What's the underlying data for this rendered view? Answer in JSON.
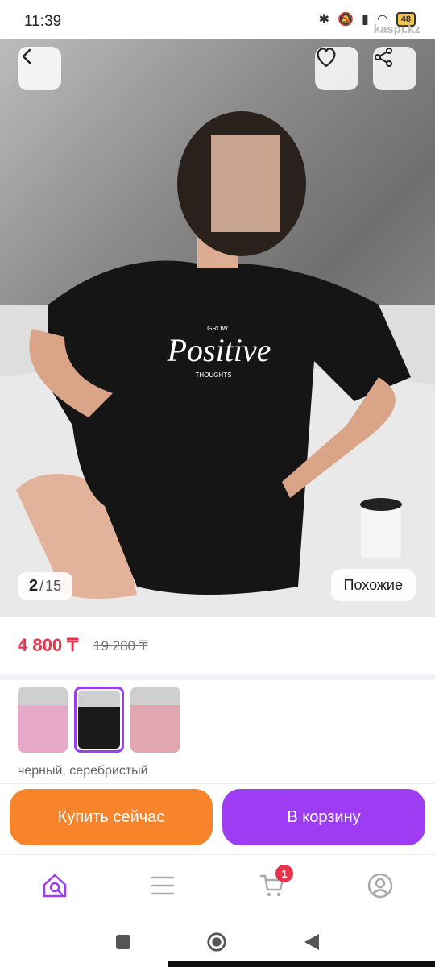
{
  "status": {
    "time": "11:39",
    "battery": "48",
    "watermark": "kaspi.kz"
  },
  "hero": {
    "shirt_text": {
      "top": "GROW",
      "main": "Positive",
      "bottom": "THOUGHTS"
    },
    "counter": {
      "current": "2",
      "separator": "/",
      "total": "15"
    },
    "similar_label": "Похожие"
  },
  "price": {
    "current": "4 800 ₸",
    "old": "19 280 ₸"
  },
  "variants": {
    "selected_name": "черный, серебристый",
    "thumbs": [
      {
        "color": "#e6a9c9"
      },
      {
        "color": "#1a1a1a"
      },
      {
        "color": "#e1a7b0"
      }
    ]
  },
  "actions": {
    "buy_now": "Купить сейчас",
    "add_to_cart": "В корзину"
  },
  "tabs": {
    "cart_badge": "1"
  },
  "colors": {
    "accent_purple": "#9d3cf2",
    "accent_orange": "#f7842b",
    "price_red": "#e8334a"
  }
}
